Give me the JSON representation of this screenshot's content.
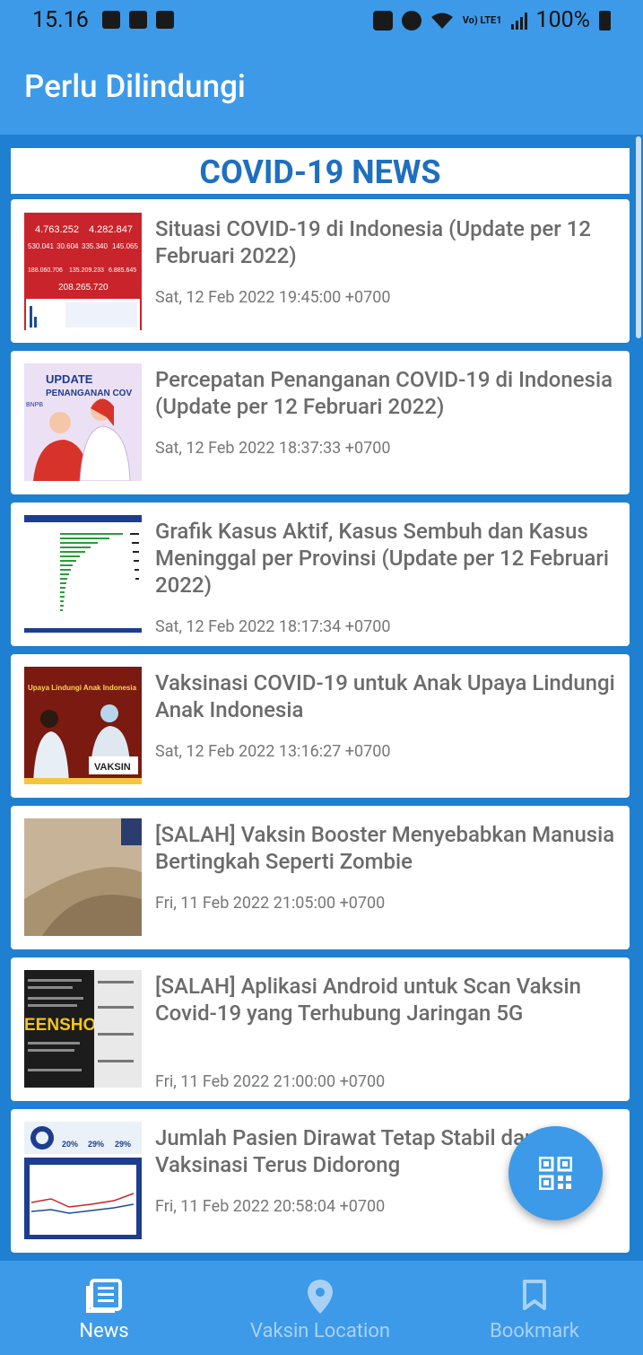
{
  "status_bar": {
    "time": "15.16",
    "battery": "100%",
    "volte_label": "Vo) LTE1"
  },
  "app_bar": {
    "title": "Perlu Dilindungi"
  },
  "section": {
    "title": "COVID-19 NEWS"
  },
  "news": [
    {
      "title": "Situasi COVID-19 di Indonesia (Update per 12 Februari 2022)",
      "date": "Sat, 12 Feb 2022 19:45:00 +0700"
    },
    {
      "title": "Percepatan Penanganan COVID-19 di Indonesia (Update per 12 Februari 2022)",
      "date": "Sat, 12 Feb 2022 18:37:33 +0700"
    },
    {
      "title": "Grafik Kasus Aktif, Kasus Sembuh dan Kasus Meninggal per Provinsi (Update per 12 Februari 2022)",
      "date": "Sat, 12 Feb 2022 18:17:34 +0700"
    },
    {
      "title": "Vaksinasi COVID-19 untuk Anak Upaya Lindungi Anak Indonesia",
      "date": "Sat, 12 Feb 2022 13:16:27 +0700"
    },
    {
      "title": "[SALAH] Vaksin Booster Menyebabkan Manusia Bertingkah Seperti Zombie",
      "date": "Fri, 11 Feb 2022 21:05:00 +0700"
    },
    {
      "title": "[SALAH] Aplikasi Android untuk Scan Vaksin Covid-19 yang Terhubung Jaringan 5G",
      "date": "Fri, 11 Feb 2022 21:00:00 +0700"
    },
    {
      "title": "Jumlah Pasien Dirawat Tetap Stabil dan Vaksinasi Terus Didorong",
      "date": "Fri, 11 Feb 2022 20:58:04 +0700"
    }
  ],
  "thumbnails": {
    "t1_stats": [
      "4.763.252",
      "4.282.847",
      "530.041",
      "30.604",
      "335.340",
      "145.065",
      "188.060.706",
      "135.209.233",
      "6.885.645",
      "208.265.720"
    ],
    "t2_heading": "UPDATE",
    "t2_sub": "PENANGANAN COV",
    "t2_brand": "BNPB",
    "t4_heading": "Upaya Lindungi Anak Indonesia",
    "t4_sign": "VAKSIN",
    "t6_watermark": "EENSHOT BY",
    "t7_pcts": [
      "20%",
      "29%",
      "29%"
    ]
  },
  "bottom_nav": [
    {
      "label": "News",
      "icon": "news-icon",
      "active": true
    },
    {
      "label": "Vaksin Location",
      "icon": "location-pin-icon",
      "active": false
    },
    {
      "label": "Bookmark",
      "icon": "bookmark-icon",
      "active": false
    }
  ],
  "fab": {
    "icon": "qr-code-icon"
  },
  "colors": {
    "primary": "#3d9ae8",
    "background": "#1f7fd0",
    "section_title": "#1f6fbf",
    "headline": "#6b6b6b"
  }
}
